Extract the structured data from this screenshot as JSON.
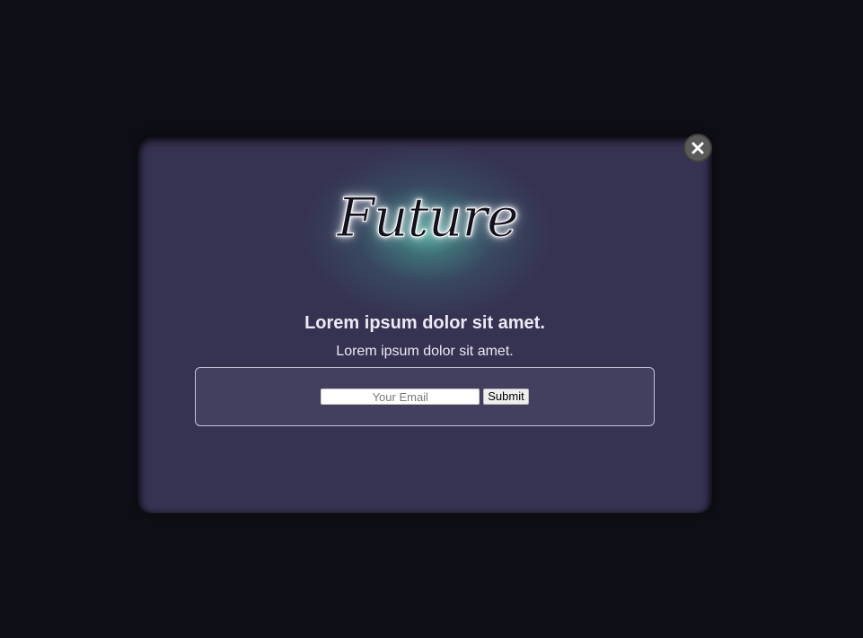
{
  "modal": {
    "logo_text": "Future",
    "headline": "Lorem ipsum dolor sit amet.",
    "subline": "Lorem ipsum dolor sit amet.",
    "form": {
      "email_placeholder": "Your Email",
      "email_value": "",
      "submit_label": "Submit"
    },
    "close_icon": "close-icon"
  },
  "colors": {
    "backdrop": "#0e0e16",
    "modal_bg": "#363251",
    "form_bg": "#433f5e",
    "glow": "#5fcdb9",
    "text": "#eceaf6",
    "close_btn": "#5a5a5a"
  }
}
